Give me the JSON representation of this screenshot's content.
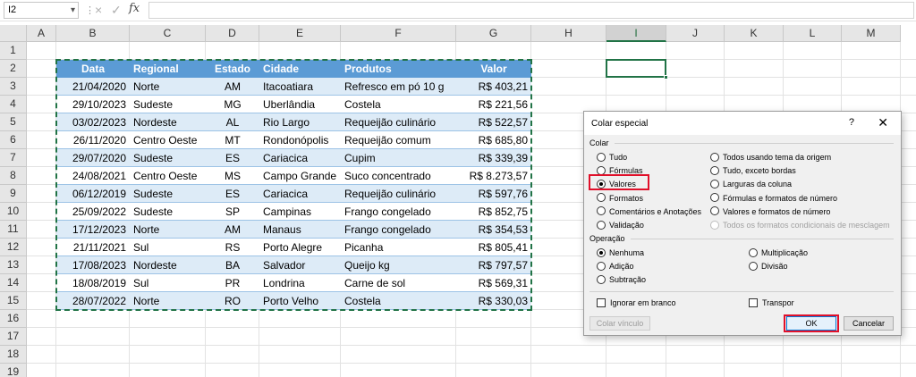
{
  "formula_bar": {
    "name_box": "I2",
    "cancel_icon": "×",
    "confirm_icon": "✓",
    "fx_label": "fx",
    "formula": ""
  },
  "columns": [
    "A",
    "B",
    "C",
    "D",
    "E",
    "F",
    "G",
    "H",
    "I",
    "J",
    "K",
    "L",
    "M"
  ],
  "selected_column": "I",
  "rows": [
    "1",
    "2",
    "3",
    "4",
    "5",
    "6",
    "7",
    "8",
    "9",
    "10",
    "11",
    "12",
    "13",
    "14",
    "15",
    "16",
    "17",
    "18",
    "19"
  ],
  "table": {
    "headers": [
      "Data",
      "Regional",
      "Estado",
      "Cidade",
      "Produtos",
      "Valor"
    ],
    "rows": [
      [
        "21/04/2020",
        "Norte",
        "AM",
        "Itacoatiara",
        "Refresco em pó 10 g",
        "R$ 403,21"
      ],
      [
        "29/10/2023",
        "Sudeste",
        "MG",
        "Uberlândia",
        "Costela",
        "R$ 221,56"
      ],
      [
        "03/02/2023",
        "Nordeste",
        "AL",
        "Rio Largo",
        "Requeijão culinário",
        "R$ 522,57"
      ],
      [
        "26/11/2020",
        "Centro Oeste",
        "MT",
        "Rondonópolis",
        "Requeijão comum",
        "R$ 685,80"
      ],
      [
        "29/07/2020",
        "Sudeste",
        "ES",
        "Cariacica",
        "Cupim",
        "R$ 339,39"
      ],
      [
        "24/08/2021",
        "Centro Oeste",
        "MS",
        "Campo Grande",
        "Suco concentrado",
        "R$ 8.273,57"
      ],
      [
        "06/12/2019",
        "Sudeste",
        "ES",
        "Cariacica",
        "Requeijão culinário",
        "R$ 597,76"
      ],
      [
        "25/09/2022",
        "Sudeste",
        "SP",
        "Campinas",
        "Frango congelado",
        "R$ 852,75"
      ],
      [
        "17/12/2023",
        "Norte",
        "AM",
        "Manaus",
        "Frango congelado",
        "R$ 354,53"
      ],
      [
        "21/11/2021",
        "Sul",
        "RS",
        "Porto Alegre",
        "Picanha",
        "R$ 805,41"
      ],
      [
        "17/08/2023",
        "Nordeste",
        "BA",
        "Salvador",
        "Queijo kg",
        "R$ 797,57"
      ],
      [
        "18/08/2019",
        "Sul",
        "PR",
        "Londrina",
        "Carne de sol",
        "R$ 569,31"
      ],
      [
        "28/07/2022",
        "Norte",
        "RO",
        "Porto Velho",
        "Costela",
        "R$ 330,03"
      ]
    ]
  },
  "colors": {
    "header_fill": "#5b9bd5",
    "band_fill": "#ddebf7",
    "selection": "#217346",
    "highlight": "#e0102a"
  },
  "dialog": {
    "title": "Colar especial",
    "help": "?",
    "close": "✕",
    "colar_group": "Colar",
    "colar_left": [
      "Tudo",
      "Fórmulas",
      "Valores",
      "Formatos",
      "Comentários e Anotações",
      "Validação"
    ],
    "colar_right": [
      "Todos usando tema da origem",
      "Tudo, exceto bordas",
      "Larguras da coluna",
      "Fórmulas e formatos de número",
      "Valores e formatos de número",
      "Todos os formatos condicionais de mesclagem"
    ],
    "colar_selected": "Valores",
    "operacao_group": "Operação",
    "operacao_left": [
      "Nenhuma",
      "Adição",
      "Subtração"
    ],
    "operacao_right": [
      "Multiplicação",
      "Divisão"
    ],
    "operacao_selected": "Nenhuma",
    "ignorar_label": "Ignorar em branco",
    "transpor_label": "Transpor",
    "colar_vinculo": "Colar vínculo",
    "ok": "OK",
    "cancelar": "Cancelar"
  }
}
